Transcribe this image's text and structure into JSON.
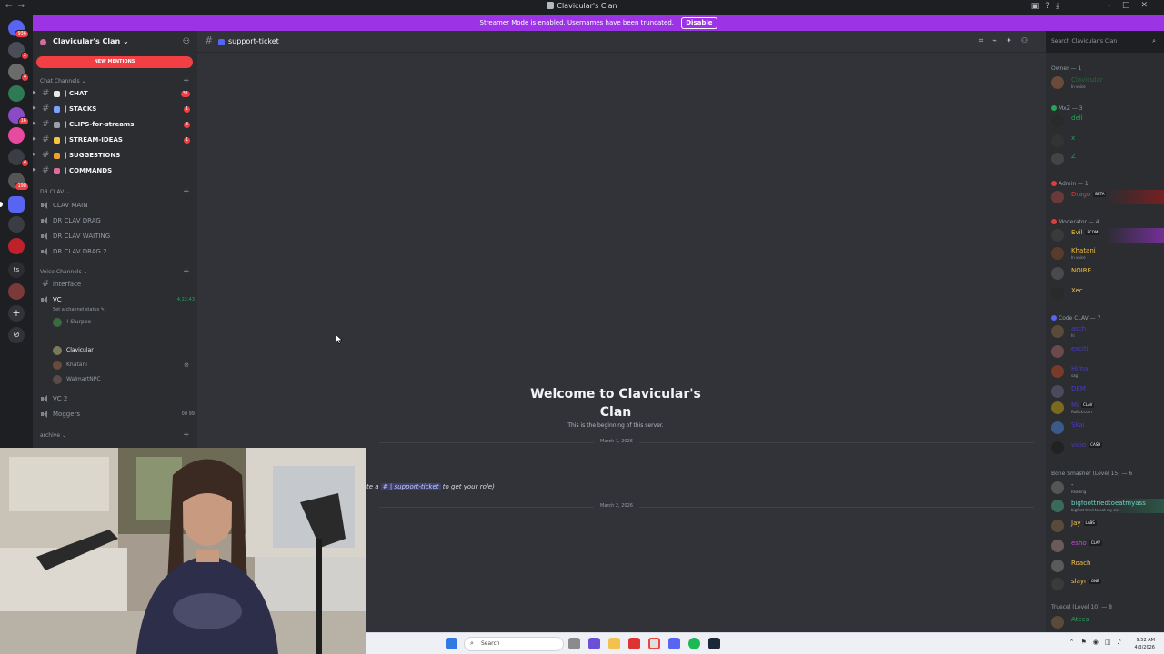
{
  "window": {
    "title": "Clavicular's Clan"
  },
  "banner": {
    "text": "Streamer Mode is enabled. Usernames have been truncated.",
    "button": "Disable"
  },
  "rail": {
    "badges": [
      "936",
      "2",
      "4",
      "16",
      "4",
      "198",
      "ts"
    ]
  },
  "server": {
    "name": "Clavicular's Clan",
    "new_mentions": "NEW MENTIONS"
  },
  "categories": {
    "chat": "Chat Channels",
    "drclav": "DR CLAV",
    "voice": "Voice Channels",
    "archive": "archive"
  },
  "channels": [
    {
      "label": "| CHAT",
      "count": "31",
      "color": "#e8e8e8"
    },
    {
      "label": "| STACKS",
      "count": "1",
      "color": "#7aa2ff"
    },
    {
      "label": "| CLIPS-for-streams",
      "count": "3",
      "color": "#9aa0a6"
    },
    {
      "label": "| STREAM-IDEAS",
      "count": "1",
      "color": "#f5c542"
    },
    {
      "label": "| SUGGESTIONS",
      "count": "",
      "color": "#f0a030"
    },
    {
      "label": "| COMMANDS",
      "count": "",
      "color": "#e06aa0"
    }
  ],
  "drclav_channels": [
    "CLAV MAIN",
    "DR CLAV DRAG",
    "DR CLAV WAITING",
    "DR CLAV DRAG 2"
  ],
  "voice": {
    "interface": "interface",
    "vc": "VC",
    "vc_time": "4:22:43",
    "vc_status": "Set a channel status",
    "users": [
      "! Slurpee",
      "Clavicular",
      "Khatani",
      "WalmartNPC"
    ],
    "vc2": "VC 2",
    "moggers": "Moggers",
    "moggers_counts": "00 99"
  },
  "header": {
    "channel": "support-ticket",
    "search_placeholder": "Search Clavicular's Clan"
  },
  "chat": {
    "welcome": "Welcome to Clavicular's Clan",
    "begin": "This is the beginning of this server.",
    "date1": "March 1, 2026",
    "date2": "March 2, 2026",
    "sys_prefix": "te a",
    "sys_mention": "# | support-ticket",
    "sys_suffix": "to get your role)"
  },
  "members": {
    "roles": [
      {
        "name": "Owner — 1",
        "color": "#949ba4"
      },
      {
        "name": "MxZ — 3",
        "color": "#949ba4"
      },
      {
        "name": "Admin — 1",
        "color": "#949ba4"
      },
      {
        "name": "Moderator — 4",
        "color": "#949ba4"
      },
      {
        "name": "Code CLAV — 7",
        "color": "#949ba4"
      },
      {
        "name": "Bone Smasher (Level 15) — 6",
        "color": "#949ba4"
      },
      {
        "name": "Truecel (Level 10) — 8",
        "color": "#949ba4"
      }
    ],
    "list": [
      {
        "name": "Clavicular",
        "color": "#2b6a3a",
        "sub": "In voice",
        "tag": ""
      },
      {
        "name": "dell",
        "color": "#23a55a",
        "sub": "",
        "tag": ""
      },
      {
        "name": "x",
        "color": "#23a55a",
        "sub": "",
        "tag": ""
      },
      {
        "name": "Z",
        "color": "#23a55a",
        "sub": "",
        "tag": ""
      },
      {
        "name": "Drago",
        "color": "#e03c3c",
        "sub": "",
        "tag": "BETA"
      },
      {
        "name": "Evil",
        "color": "#f0c040",
        "sub": "",
        "tag": "ECOM"
      },
      {
        "name": "Khatani",
        "color": "#f0c040",
        "sub": "In voice",
        "tag": ""
      },
      {
        "name": "NOIRE",
        "color": "#f0c040",
        "sub": "",
        "tag": ""
      },
      {
        "name": "Xec",
        "color": "#f0c040",
        "sub": "",
        "tag": ""
      },
      {
        "name": "asch",
        "color": "#4a3bc0",
        "sub": "hi",
        "tag": ""
      },
      {
        "name": "exciti",
        "color": "#4a3bc0",
        "sub": "",
        "tag": ""
      },
      {
        "name": "Hima",
        "color": "#4a3bc0",
        "sub": "sag",
        "tag": ""
      },
      {
        "name": "DEM",
        "color": "#4a3bc0",
        "sub": "",
        "tag": ""
      },
      {
        "name": "Mi",
        "color": "#4a3bc0",
        "sub": "Rollick.com",
        "tag": "CLAV"
      },
      {
        "name": "Skai",
        "color": "#4a3bc0",
        "sub": "",
        "tag": ""
      },
      {
        "name": "vicio",
        "color": "#4a3bc0",
        "sub": "",
        "tag": "CASH"
      },
      {
        "name": "-",
        "color": "#b5bac1",
        "sub": "Reading",
        "tag": ""
      },
      {
        "name": "bigfoottriedtoeatmyass",
        "color": "#6fd1c0",
        "sub": "bigfoot tried to eat my ass",
        "tag": ""
      },
      {
        "name": "Jay",
        "color": "#f2c14e",
        "sub": "",
        "tag": "LABS"
      },
      {
        "name": "esho",
        "color": "#c04ad0",
        "sub": "",
        "tag": "CLAV"
      },
      {
        "name": "Roach",
        "color": "#f2c14e",
        "sub": "",
        "tag": ""
      },
      {
        "name": "slayr",
        "color": "#f2c14e",
        "sub": "",
        "tag": "ONE"
      },
      {
        "name": "Atecs",
        "color": "#23a55a",
        "sub": "",
        "tag": ""
      }
    ]
  },
  "taskbar": {
    "search": "Search",
    "time": "9:52 AM",
    "date": "4/3/2026"
  }
}
